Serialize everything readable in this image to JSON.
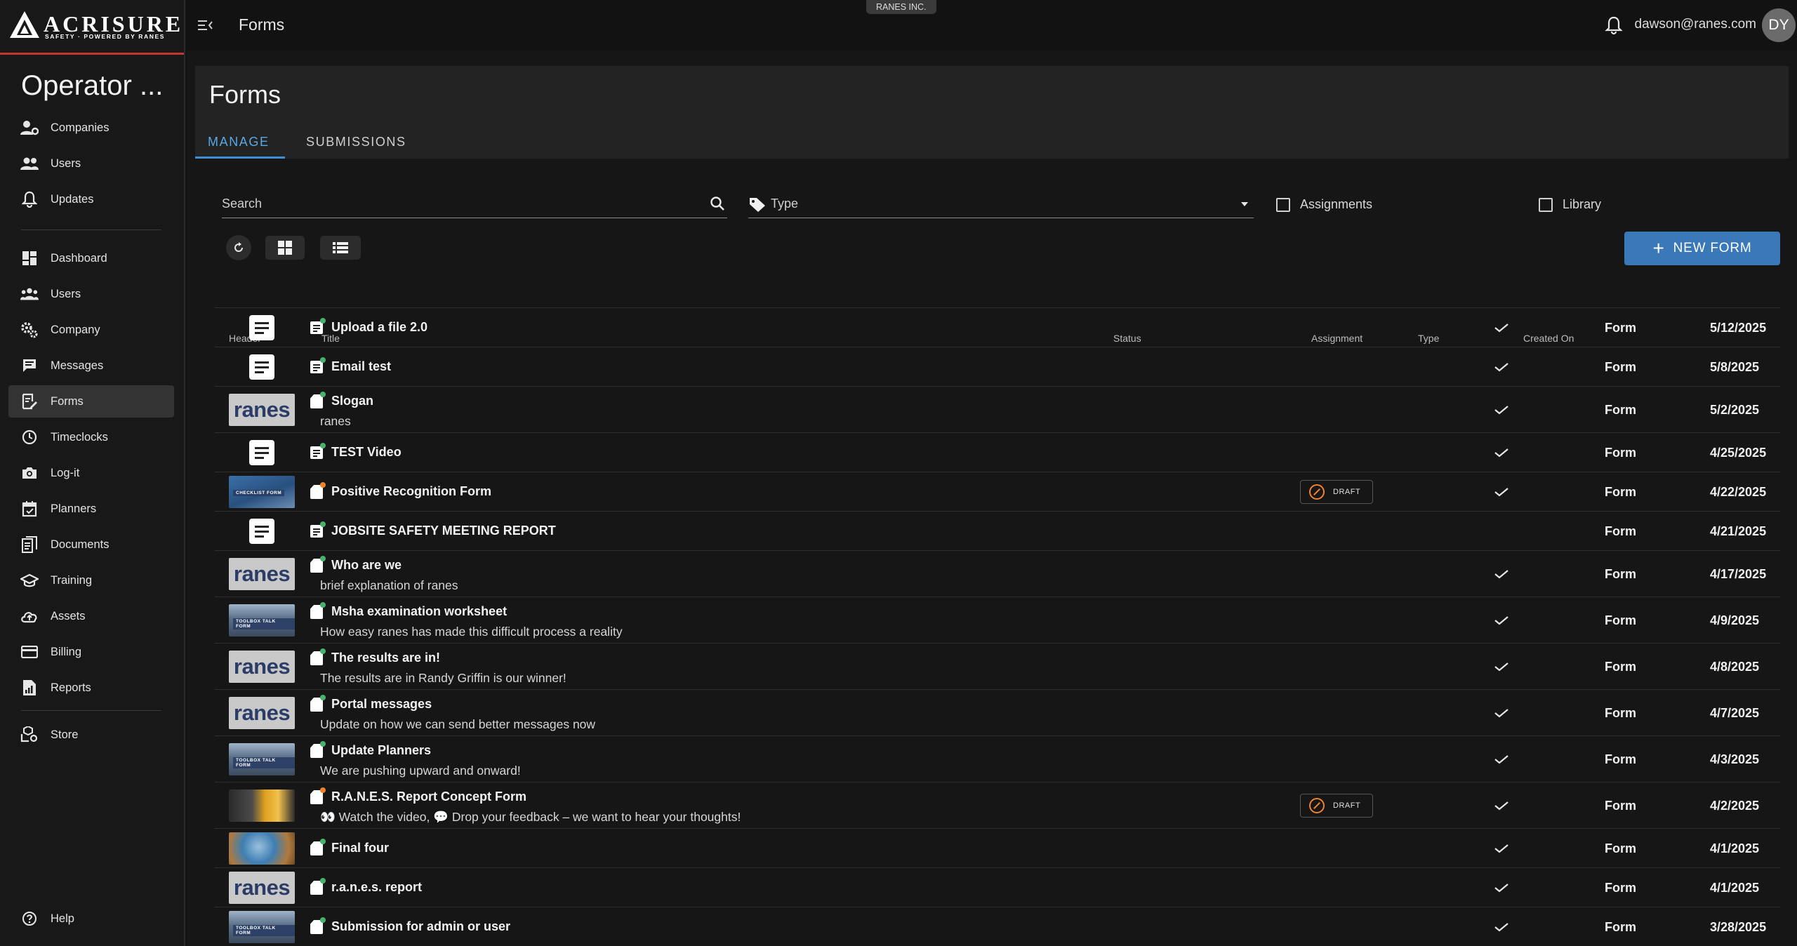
{
  "brand": {
    "name": "ACRISURE",
    "tagline": "SAFETY · POWERED BY RANES"
  },
  "sidebar": {
    "org_title": "Operator ...",
    "items": [
      {
        "label": "Companies",
        "icon": "companies-icon"
      },
      {
        "label": "Users",
        "icon": "users-icon"
      },
      {
        "label": "Updates",
        "icon": "bell-icon"
      },
      {
        "label": "Dashboard",
        "icon": "dashboard-icon"
      },
      {
        "label": "Users",
        "icon": "users-group-icon"
      },
      {
        "label": "Company",
        "icon": "gears-icon"
      },
      {
        "label": "Messages",
        "icon": "messages-icon"
      },
      {
        "label": "Forms",
        "icon": "forms-icon"
      },
      {
        "label": "Timeclocks",
        "icon": "clock-icon"
      },
      {
        "label": "Log-it",
        "icon": "camera-icon"
      },
      {
        "label": "Planners",
        "icon": "calendar-icon"
      },
      {
        "label": "Documents",
        "icon": "documents-icon"
      },
      {
        "label": "Training",
        "icon": "graduation-cap-icon"
      },
      {
        "label": "Assets",
        "icon": "cloud-upload-icon"
      },
      {
        "label": "Billing",
        "icon": "credit-card-icon"
      },
      {
        "label": "Reports",
        "icon": "report-icon"
      },
      {
        "label": "Store",
        "icon": "store-icon"
      },
      {
        "label": "Help",
        "icon": "help-icon"
      }
    ]
  },
  "topbar": {
    "title": "Forms",
    "tenant": "RANES INC.",
    "user_email": "dawson@ranes.com",
    "avatar_initials": "DY"
  },
  "page": {
    "title": "Forms",
    "tabs": [
      "MANAGE",
      "SUBMISSIONS"
    ],
    "search_label": "Search",
    "type_label": "Type",
    "assignments_label": "Assignments",
    "library_label": "Library",
    "new_form_label": "NEW FORM"
  },
  "table": {
    "headers": [
      "Header",
      "Title",
      "Status",
      "Assignment",
      "Type",
      "Created On"
    ],
    "rows": [
      {
        "thumb": "doc",
        "title": "Upload a file 2.0",
        "subtitle": "",
        "status": "",
        "assigned": true,
        "type": "Form",
        "created": "5/12/2025"
      },
      {
        "thumb": "doc",
        "title": "Email test",
        "subtitle": "",
        "status": "",
        "assigned": true,
        "type": "Form",
        "created": "5/8/2025"
      },
      {
        "thumb": "ranes",
        "title": "Slogan",
        "subtitle": "ranes",
        "status": "",
        "assigned": true,
        "type": "Form",
        "created": "5/2/2025"
      },
      {
        "thumb": "doc",
        "title": "TEST Video",
        "subtitle": "",
        "status": "",
        "assigned": true,
        "type": "Form",
        "created": "4/25/2025"
      },
      {
        "thumb": "checklist",
        "title": "Positive Recognition Form",
        "subtitle": "",
        "status": "DRAFT",
        "assigned": true,
        "type": "Form",
        "created": "4/22/2025"
      },
      {
        "thumb": "doc",
        "title": "JOBSITE SAFETY MEETING REPORT",
        "subtitle": "",
        "status": "",
        "assigned": false,
        "type": "Form",
        "created": "4/21/2025"
      },
      {
        "thumb": "ranes",
        "title": "Who are we",
        "subtitle": "brief explanation of ranes",
        "status": "",
        "assigned": true,
        "type": "Form",
        "created": "4/17/2025"
      },
      {
        "thumb": "toolbox",
        "title": "Msha examination worksheet",
        "subtitle": "How easy ranes has made this difficult process a reality",
        "status": "",
        "assigned": true,
        "type": "Form",
        "created": "4/9/2025"
      },
      {
        "thumb": "ranes",
        "title": "The results are in!",
        "subtitle": "The results are in Randy Griffin is our winner!",
        "status": "",
        "assigned": true,
        "type": "Form",
        "created": "4/8/2025"
      },
      {
        "thumb": "ranes",
        "title": "Portal messages",
        "subtitle": "Update on how we can send better messages now",
        "status": "",
        "assigned": true,
        "type": "Form",
        "created": "4/7/2025"
      },
      {
        "thumb": "toolbox",
        "title": "Update Planners",
        "subtitle": "We are pushing upward and onward!",
        "status": "",
        "assigned": true,
        "type": "Form",
        "created": "4/3/2025"
      },
      {
        "thumb": "helmet",
        "title": "R.A.N.E.S. Report Concept Form",
        "subtitle": "👀 Watch the video, 💬 Drop your feedback – we want to hear your thoughts!",
        "status": "DRAFT",
        "assigned": true,
        "type": "Form",
        "created": "4/2/2025"
      },
      {
        "thumb": "globe",
        "title": "Final four",
        "subtitle": "",
        "status": "",
        "assigned": true,
        "type": "Form",
        "created": "4/1/2025"
      },
      {
        "thumb": "ranes",
        "title": "r.a.n.e.s. report",
        "subtitle": "",
        "status": "",
        "assigned": true,
        "type": "Form",
        "created": "4/1/2025"
      },
      {
        "thumb": "toolbox",
        "title": "Submission for admin or user",
        "subtitle": "",
        "status": "",
        "assigned": true,
        "type": "Form",
        "created": "3/28/2025"
      }
    ]
  },
  "thumb_captions": {
    "checklist": "CHECKLIST FORM",
    "toolbox": "TOOLBOX TALK FORM",
    "ranes": "ranes"
  },
  "colors": {
    "accent": "#3d8fd6",
    "primary_button": "#3a78b8",
    "brand_red": "#c8352b",
    "delete": "#e0443a",
    "copy": "#3d8fd6",
    "draft": "#f0832a",
    "status_dot_green": "#45b36b",
    "status_dot_orange": "#f0832a"
  }
}
